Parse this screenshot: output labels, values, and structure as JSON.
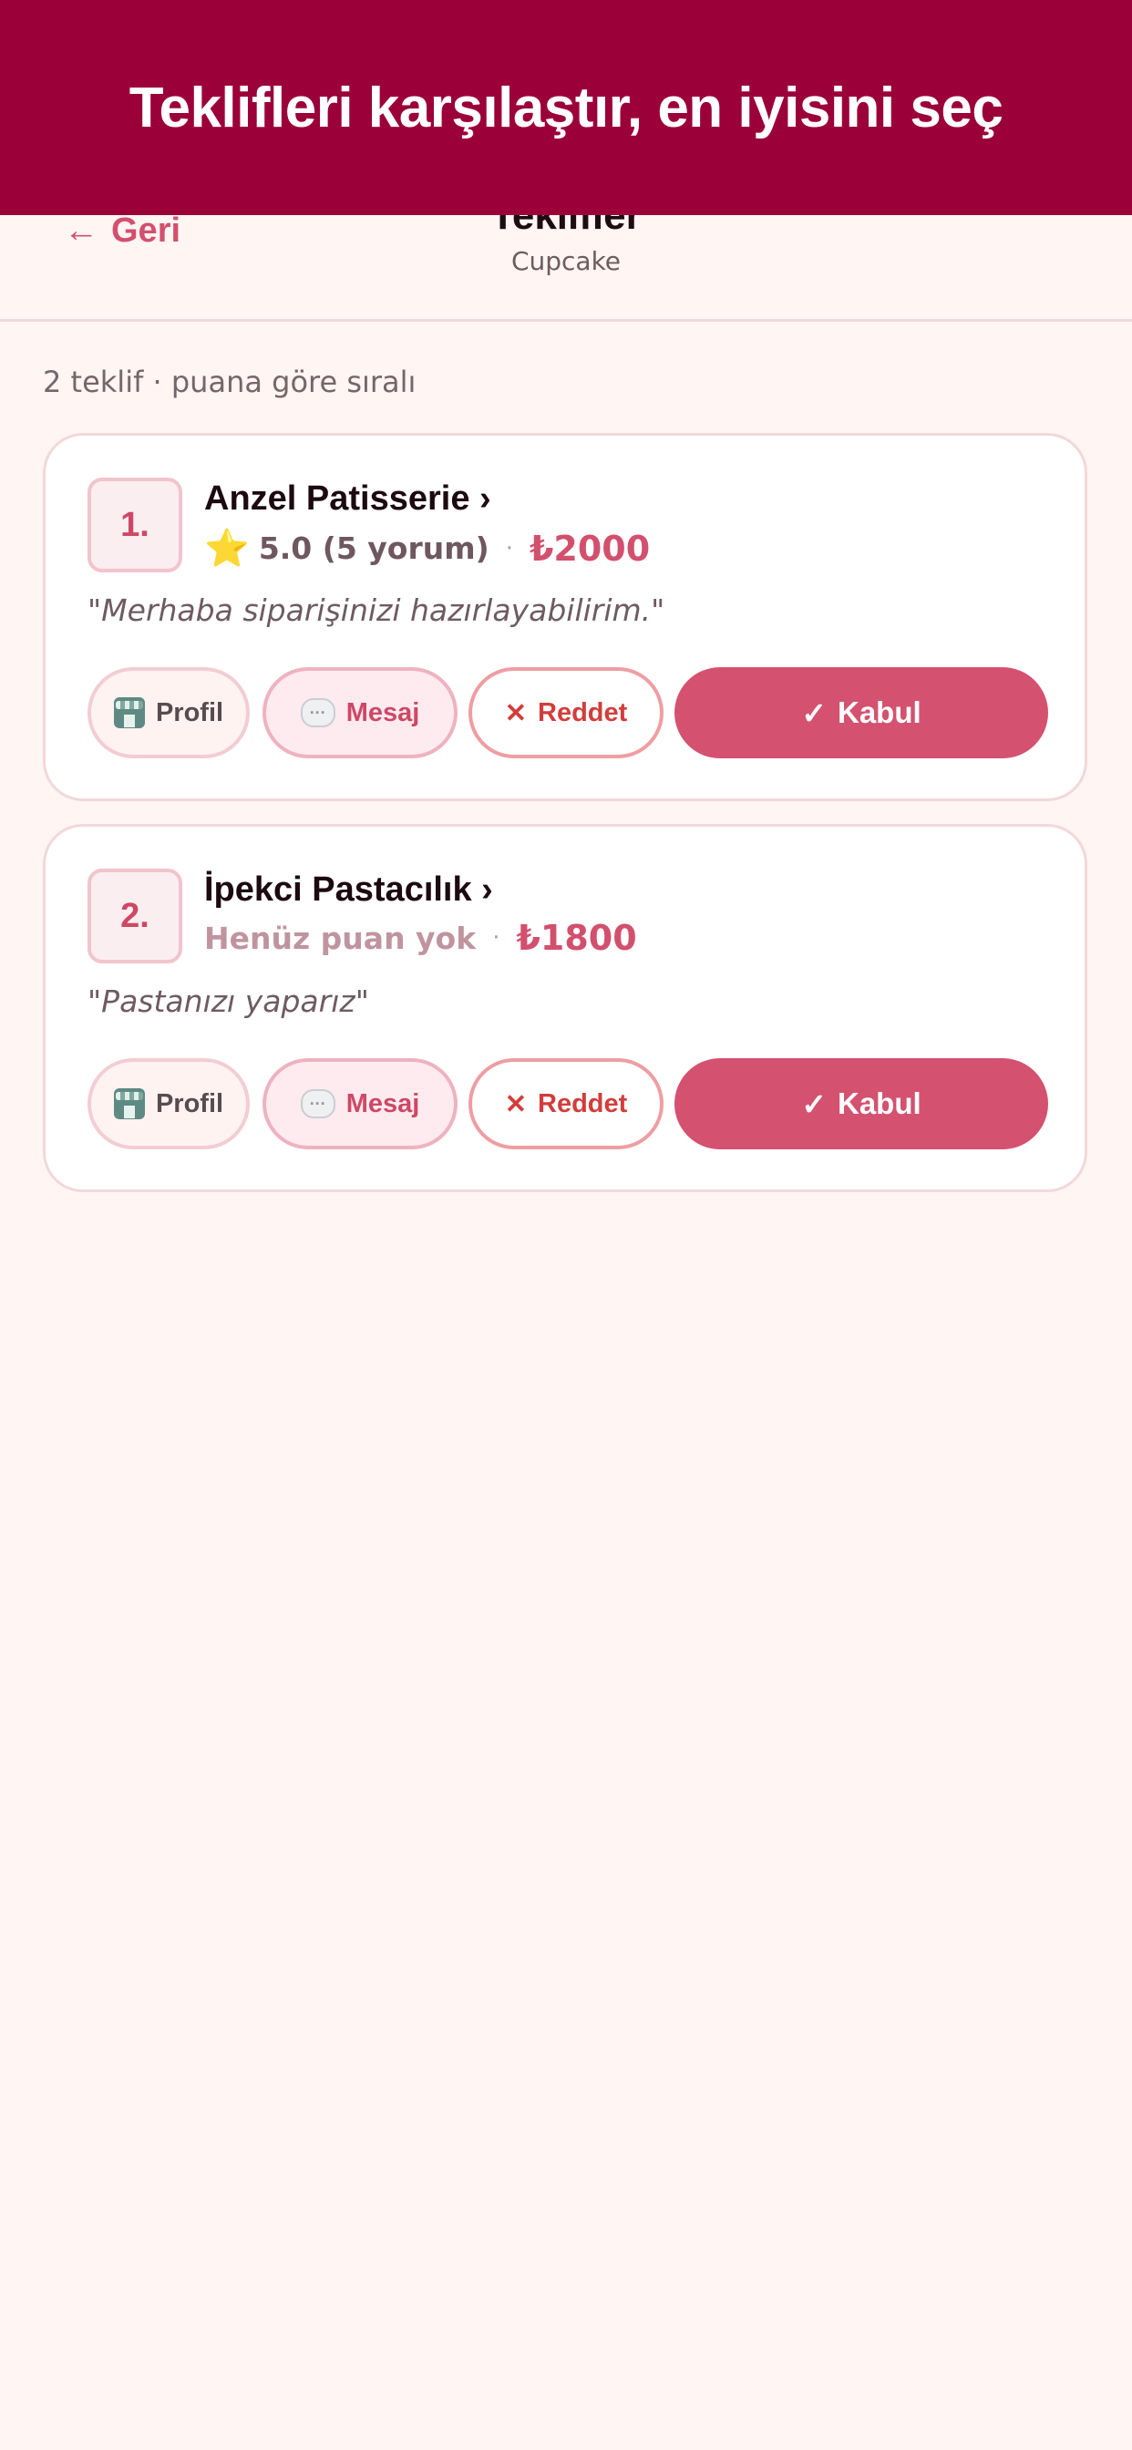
{
  "banner": {
    "text": "Teklifleri karşılaştır, en iyisini seç"
  },
  "header": {
    "back_label": "Geri",
    "back_arrow": "←",
    "title": "Teklifler",
    "subtitle": "Cupcake"
  },
  "summary": "2 teklif · puana göre sıralı",
  "offers": [
    {
      "rank": "1.",
      "name": "Anzel Patisserie ›",
      "star": "⭐",
      "rating": "5.0 (5 yorum)",
      "dot": "·",
      "price": "₺2000",
      "quote": "\"Merhaba siparişinizi hazırlayabilirim.\"",
      "buttons": {
        "profile": "Profil",
        "message": "Mesaj",
        "reject": "Reddet",
        "reject_icon": "✕",
        "accept": "Kabul",
        "accept_icon": "✓"
      }
    },
    {
      "rank": "2.",
      "name": "İpekci Pastacılık ›",
      "rating": "Henüz puan yok",
      "dot": "·",
      "price": "₺1800",
      "quote": "\"Pastanızı yaparız\"",
      "buttons": {
        "profile": "Profil",
        "message": "Mesaj",
        "reject": "Reddet",
        "reject_icon": "✕",
        "accept": "Kabul",
        "accept_icon": "✓"
      }
    }
  ],
  "colors": {
    "banner": "#9b0039",
    "accent": "#d4526f",
    "reject": "#d23d3b",
    "background": "#fff5f3"
  },
  "icons": {
    "back": "arrow-left-icon",
    "star": "star-icon",
    "profile": "shop-icon",
    "message": "speech-bubble-icon",
    "reject": "close-icon",
    "accept": "checkmark-icon"
  }
}
